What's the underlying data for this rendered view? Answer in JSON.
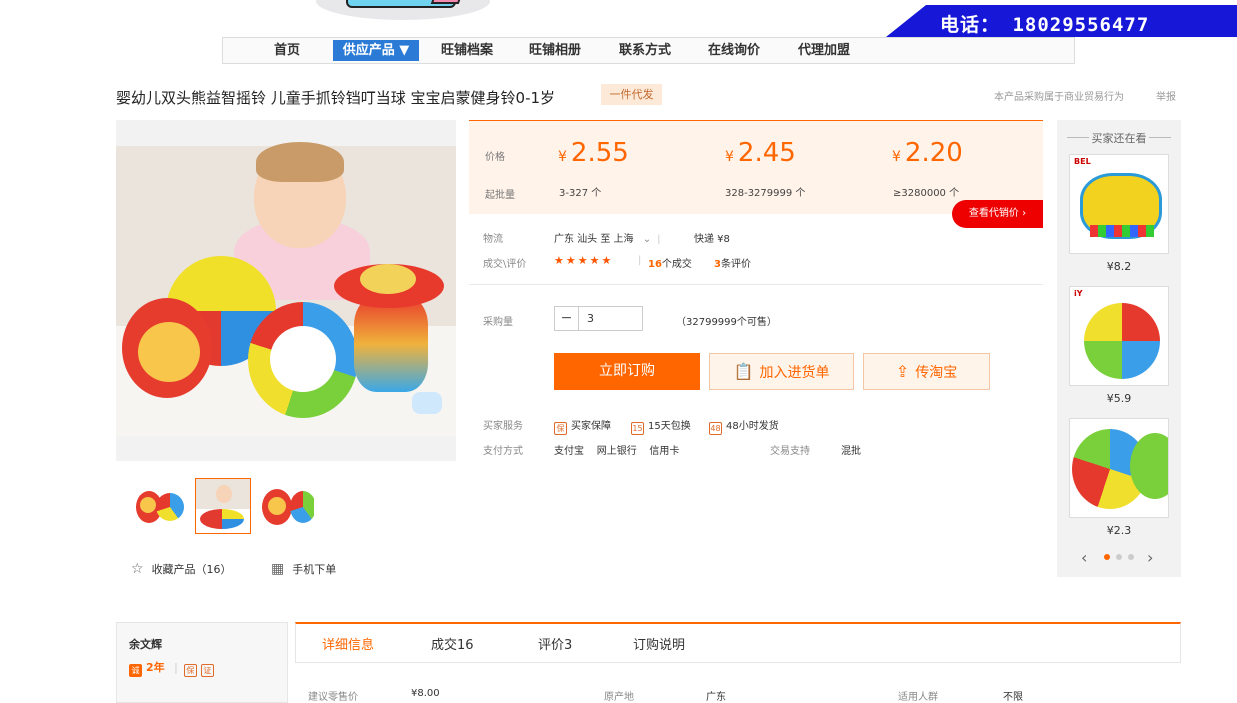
{
  "header": {
    "phone": "电话： 18029556477"
  },
  "nav": {
    "items": [
      {
        "label": "首页"
      },
      {
        "label": "供应产品 ▼"
      },
      {
        "label": "旺铺档案"
      },
      {
        "label": "旺铺相册"
      },
      {
        "label": "联系方式"
      },
      {
        "label": "在线询价"
      },
      {
        "label": "代理加盟"
      }
    ]
  },
  "product": {
    "title": "婴幼儿双头熊益智摇铃 儿童手抓铃铛叮当球 宝宝启蒙健身铃0-1岁",
    "tag": "一件代发",
    "note": "本产品采购属于商业贸易行为",
    "report": "举报",
    "favorite": "收藏产品（16）",
    "mobile_order": "手机下单"
  },
  "pricing": {
    "price_label": "价格",
    "qty_label": "起批量",
    "currency": "¥",
    "tiers": [
      {
        "price": "2.55",
        "qty": "3-327 个"
      },
      {
        "price": "2.45",
        "qty": "328-3279999 个"
      },
      {
        "price": "2.20",
        "qty": "≥3280000 个"
      }
    ],
    "agent_btn": "查看代销价 ›"
  },
  "logistics": {
    "label": "物流",
    "route": "广东 汕头  至  上海",
    "express": "快递 ¥8"
  },
  "deals": {
    "label": "成交\\评价",
    "stars": "★★★★★",
    "count": "16",
    "count_suffix": "个成交",
    "reviews": "3",
    "reviews_suffix": "条评价"
  },
  "purchase": {
    "label": "采购量",
    "quantity": "3",
    "available": "（32799999个可售）",
    "buy": "立即订购",
    "cart": "加入进货单",
    "taobao": "传淘宝"
  },
  "services": {
    "label": "买家服务",
    "items": [
      "买家保障",
      "15天包换",
      "48小时发货"
    ],
    "pay_label": "支付方式",
    "pay_methods": "支付宝    网上银行    信用卡",
    "trade_label": "交易支持",
    "trade_value": "混批"
  },
  "rail": {
    "title": "买家还在看",
    "prices": [
      "¥8.2",
      "¥5.9",
      "¥2.3"
    ]
  },
  "seller": {
    "name": "余文辉",
    "years": "2年"
  },
  "tabs": [
    "详细信息",
    "成交16",
    "评价3",
    "订购说明"
  ],
  "specs": [
    {
      "k": "建议零售价",
      "v": "¥8.00"
    },
    {
      "k": "原产地",
      "v": "广东"
    },
    {
      "k": "适用人群",
      "v": "不限"
    }
  ],
  "colors": {
    "accent": "#ff6600",
    "nav_active": "#2a7ad6",
    "phone_bg": "#1717d8"
  }
}
